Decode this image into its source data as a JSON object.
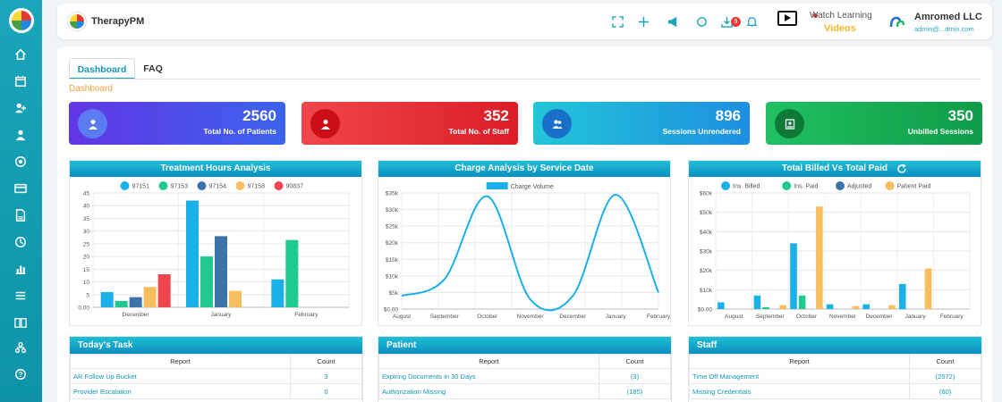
{
  "app": {
    "brand": "TherapyPM"
  },
  "header": {
    "notification_count": "9",
    "watch_line1": "Watch Learning",
    "watch_line2": "Videos",
    "org_name": "Amromed LLC",
    "org_email": "admin@...dmin.com"
  },
  "tabs": [
    "Dashboard",
    "FAQ"
  ],
  "breadcrumb": "Dashboard",
  "cards": [
    {
      "value": "2560",
      "label": "Total No. of Patients"
    },
    {
      "value": "352",
      "label": "Total No. of Staff"
    },
    {
      "value": "896",
      "label": "Sessions Unrendered"
    },
    {
      "value": "350",
      "label": "Unbilled Sessions"
    }
  ],
  "chart_data": [
    {
      "type": "bar",
      "title": "Treatment Hours Analysis",
      "categories": [
        "December",
        "January",
        "February"
      ],
      "series": [
        {
          "name": "97151",
          "values": [
            6,
            42,
            11
          ]
        },
        {
          "name": "97153",
          "values": [
            2.5,
            20,
            26.5
          ]
        },
        {
          "name": "97154",
          "values": [
            4,
            28,
            0
          ]
        },
        {
          "name": "97158",
          "values": [
            8,
            6.5,
            0
          ]
        },
        {
          "name": "90837",
          "values": [
            13,
            0,
            0
          ]
        }
      ],
      "colors": [
        "#1ab0e8",
        "#1fca8e",
        "#3c73a8",
        "#f7be5f",
        "#f0454f"
      ],
      "ylim": [
        0,
        45
      ],
      "yticks": [
        "0.00",
        "5",
        "10",
        "15",
        "20",
        "25",
        "30",
        "35",
        "40",
        "45"
      ],
      "legend": "top",
      "grid": true
    },
    {
      "type": "line",
      "title": "Charge Analysis by Service Date",
      "categories": [
        "August",
        "September",
        "October",
        "November",
        "December",
        "January",
        "February"
      ],
      "series": [
        {
          "name": "Charge Volume",
          "values": [
            4000,
            9000,
            34000,
            3000,
            4000,
            34500,
            5000
          ]
        }
      ],
      "colors": [
        "#1ab0e8"
      ],
      "ylim": [
        0,
        35000
      ],
      "yticks": [
        "$0.00",
        "$5k",
        "$10k",
        "$15k",
        "$20k",
        "$25k",
        "$30k",
        "$35k"
      ],
      "legend": "top",
      "grid": true
    },
    {
      "type": "bar",
      "title": "Total Billed Vs Total Paid",
      "categories": [
        "August",
        "September",
        "October",
        "November",
        "December",
        "January",
        "February"
      ],
      "series": [
        {
          "name": "Ins. Billed",
          "values": [
            3500,
            7000,
            34000,
            2500,
            2500,
            13000,
            0
          ]
        },
        {
          "name": "Ins. Paid",
          "values": [
            0,
            1000,
            7000,
            0,
            0,
            0,
            0
          ]
        },
        {
          "name": "Adjusted",
          "values": [
            0,
            0,
            0,
            0,
            0,
            0,
            0
          ]
        },
        {
          "name": "Patient Paid",
          "values": [
            0,
            2000,
            53000,
            1500,
            2000,
            21000,
            0
          ]
        }
      ],
      "colors": [
        "#1ab0e8",
        "#1fca8e",
        "#3c73a8",
        "#f7be5f"
      ],
      "ylim": [
        0,
        60000
      ],
      "yticks": [
        "$0.00",
        "$10k",
        "$20k",
        "$30k",
        "$40k",
        "$50k",
        "$60k"
      ],
      "legend": "top",
      "grid": true
    }
  ],
  "tables": [
    {
      "title": "Today's Task",
      "headers": [
        "Report",
        "Count"
      ],
      "rows": [
        [
          "AR Follow Up Bucket",
          "3"
        ],
        [
          "Provider Escalation",
          "0"
        ]
      ]
    },
    {
      "title": "Patient",
      "headers": [
        "Report",
        "Count"
      ],
      "rows": [
        [
          "Expiring Documents in 30 Days",
          "(3)"
        ],
        [
          "Authorization Missing",
          "(185)"
        ]
      ]
    },
    {
      "title": "Staff",
      "headers": [
        "Report",
        "Count"
      ],
      "rows": [
        [
          "Time Off Management",
          "(2572)"
        ],
        [
          "Missing Credentials",
          "(60)"
        ]
      ]
    }
  ]
}
